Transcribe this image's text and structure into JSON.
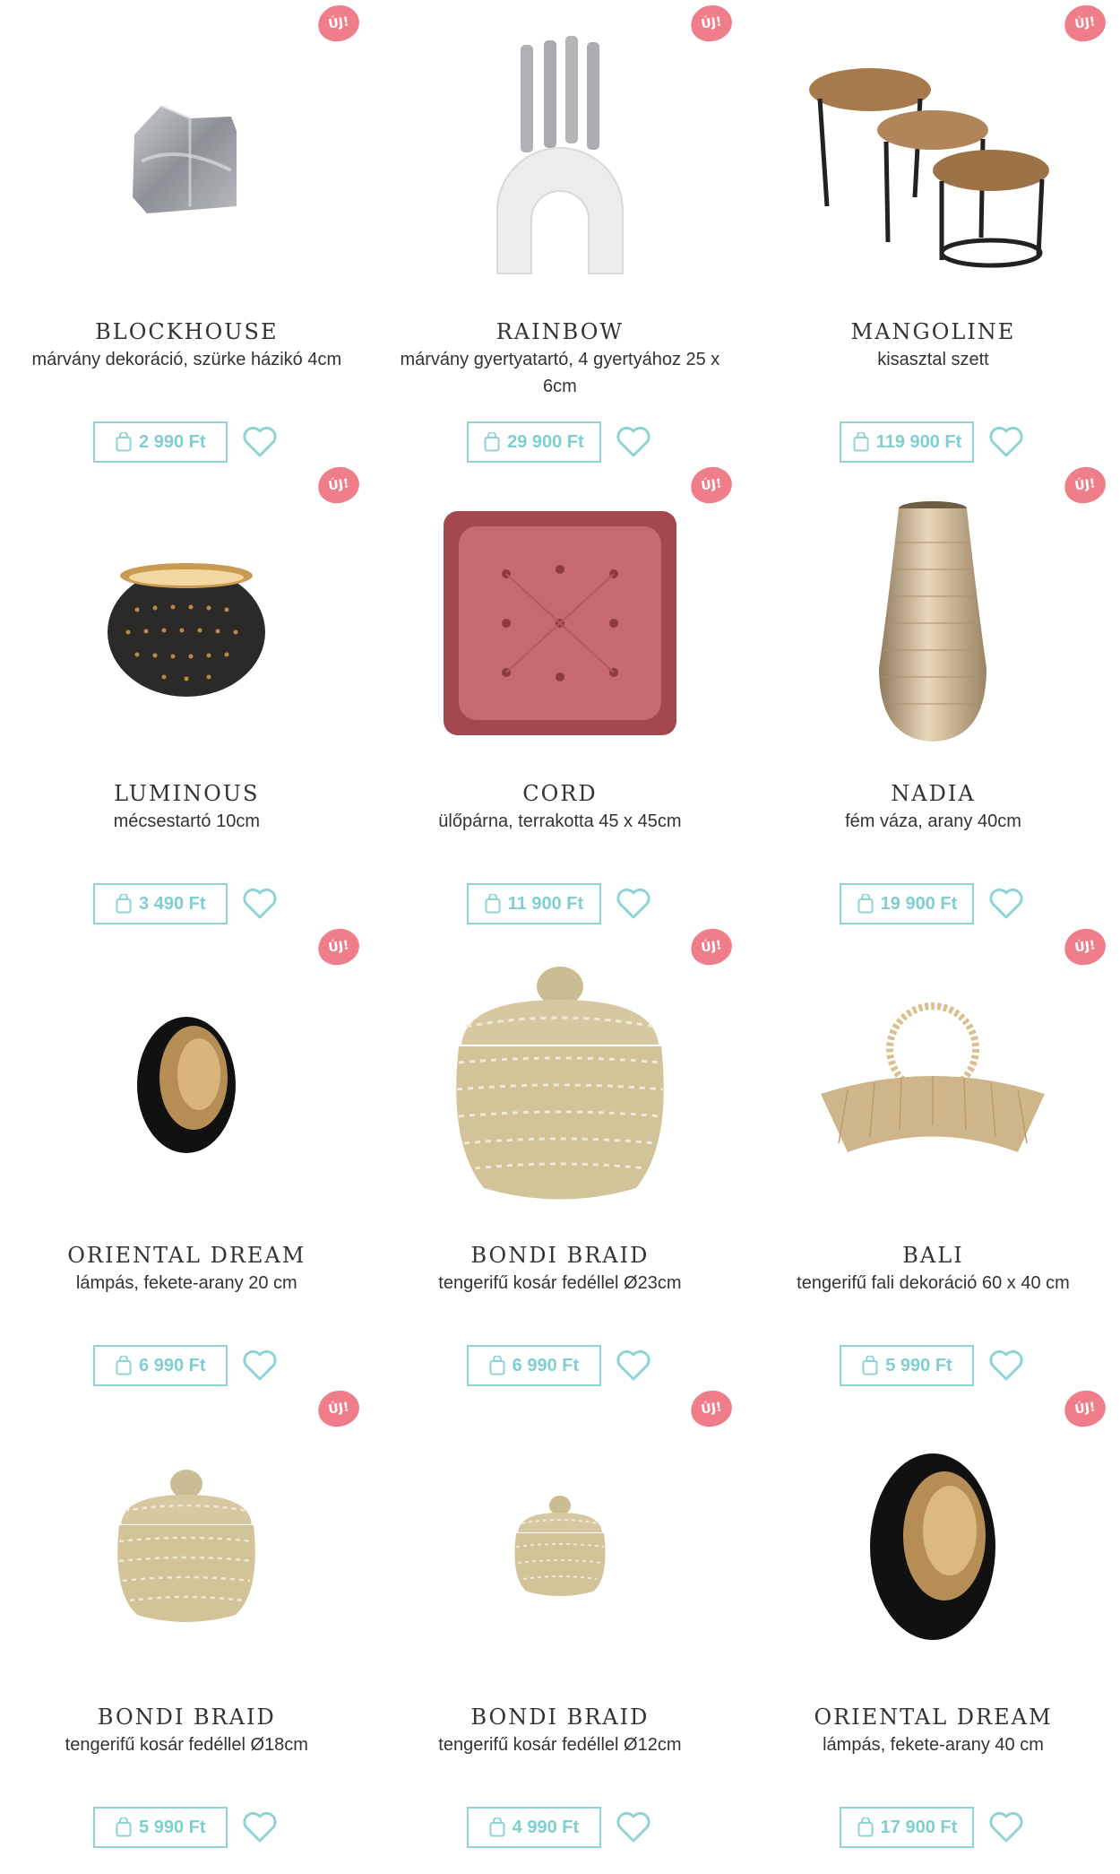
{
  "badge_label": "ÚJ!",
  "accent_color": "#8fd3d3",
  "badge_color": "#f07e8a",
  "products": [
    {
      "name": "BLOCKHOUSE",
      "desc": "márvány dekoráció, szürke házikó 4cm",
      "price": "2 990 Ft",
      "image": "marble-house"
    },
    {
      "name": "RAINBOW",
      "desc": "márvány gyertyatartó, 4 gyertyához 25 x 6cm",
      "price": "29 900 Ft",
      "image": "arch-candle-holder"
    },
    {
      "name": "MANGOLINE",
      "desc": "kisasztal szett",
      "price": "119 900 Ft",
      "image": "nesting-tables"
    },
    {
      "name": "LUMINOUS",
      "desc": "mécsestartó 10cm",
      "price": "3 490 Ft",
      "image": "tealight-holder"
    },
    {
      "name": "CORD",
      "desc": "ülőpárna, terrakotta 45 x 45cm",
      "price": "11 900 Ft",
      "image": "floor-cushion"
    },
    {
      "name": "NADIA",
      "desc": "fém váza, arany 40cm",
      "price": "19 900 Ft",
      "image": "gold-vase"
    },
    {
      "name": "ORIENTAL DREAM",
      "desc": "lámpás, fekete-arany 20 cm",
      "price": "6 990 Ft",
      "image": "egg-lantern-small"
    },
    {
      "name": "BONDI BRAID",
      "desc": "tengerifű kosár fedéllel Ø23cm",
      "price": "6 990 Ft",
      "image": "basket-large"
    },
    {
      "name": "BALI",
      "desc": "tengerifű fali dekoráció 60 x 40 cm",
      "price": "5 990 Ft",
      "image": "wall-decor"
    },
    {
      "name": "BONDI BRAID",
      "desc": "tengerifű kosár fedéllel Ø18cm",
      "price": "5 990 Ft",
      "image": "basket-medium"
    },
    {
      "name": "BONDI BRAID",
      "desc": "tengerifű kosár fedéllel Ø12cm",
      "price": "4 990 Ft",
      "image": "basket-small"
    },
    {
      "name": "ORIENTAL DREAM",
      "desc": "lámpás, fekete-arany 40 cm",
      "price": "17 900 Ft",
      "image": "egg-lantern-large"
    }
  ]
}
